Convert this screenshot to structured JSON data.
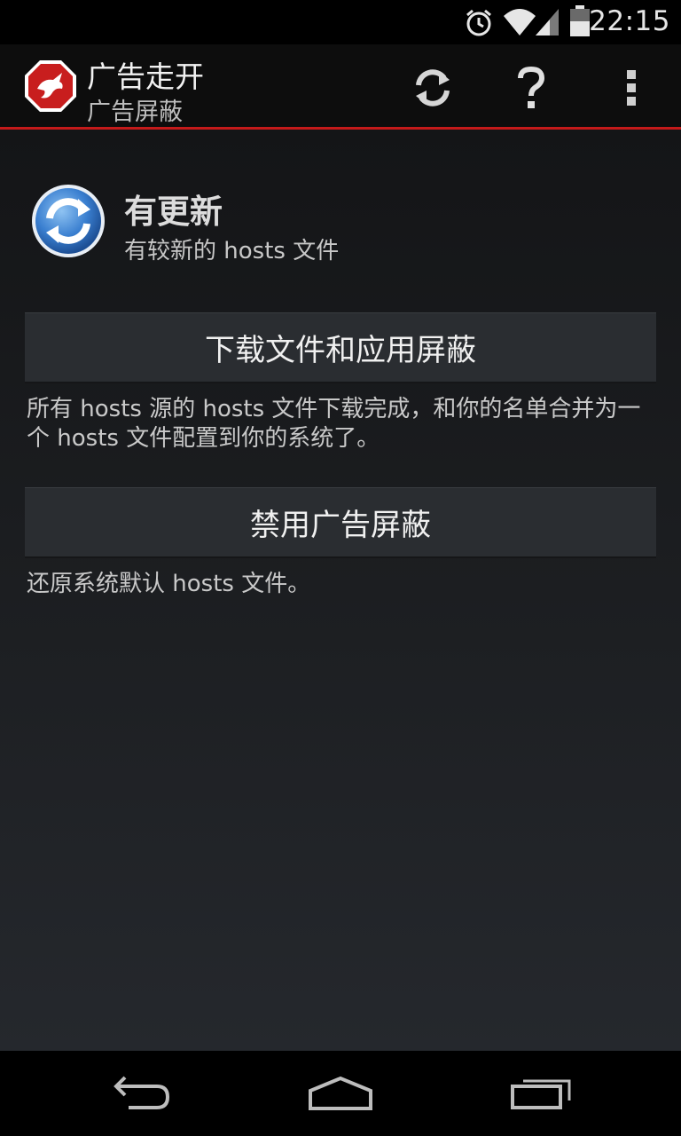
{
  "status_bar": {
    "time": "22:15",
    "icons": [
      "alarm-icon",
      "wifi-icon",
      "signal-icon",
      "battery-icon"
    ]
  },
  "action_bar": {
    "title": "广告走开",
    "subtitle": "广告屏蔽",
    "actions": [
      "refresh-icon",
      "help-icon",
      "overflow-menu-icon"
    ],
    "accent_color": "#c41a1a"
  },
  "status": {
    "title": "有更新",
    "subtitle": "有较新的 hosts 文件",
    "icon": "update-icon"
  },
  "primary_action": {
    "label": "下载文件和应用屏蔽",
    "description": "所有 hosts 源的 hosts 文件下载完成，和你的名单合并为一个 hosts 文件配置到你的系统了。"
  },
  "secondary_action": {
    "label": "禁用广告屏蔽",
    "description": "还原系统默认 hosts 文件。"
  },
  "nav_bar": {
    "buttons": [
      "back-icon",
      "home-icon",
      "recent-apps-icon"
    ]
  }
}
